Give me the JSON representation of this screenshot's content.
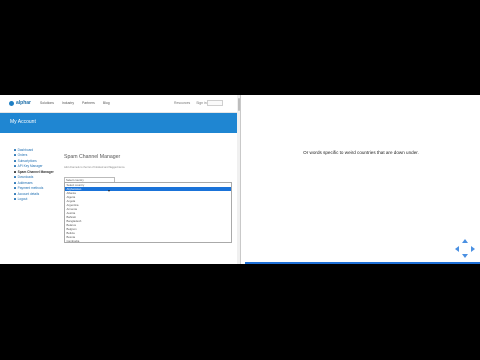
{
  "app": {
    "logo_text": "alphar",
    "nav_links": [
      "Solutions",
      "Industry",
      "Partners",
      "Blog"
    ],
    "nav_right": [
      "Resources",
      "Sign in"
    ]
  },
  "banner": {
    "title": "My Account"
  },
  "sidebar": {
    "items": [
      {
        "label": "Dashboard"
      },
      {
        "label": "Orders"
      },
      {
        "label": "Subscriptions"
      },
      {
        "label": "API Key Manager"
      },
      {
        "label": "Spam Channel Manager",
        "active": true
      },
      {
        "label": "Downloads"
      },
      {
        "label": "Addresses"
      },
      {
        "label": "Payment methods"
      },
      {
        "label": "Account details"
      },
      {
        "label": "Logout"
      }
    ]
  },
  "main": {
    "title": "Spam Channel Manager",
    "description": "Add channels to the list of blocked and flagged items.",
    "select_value": "Select country",
    "options": [
      "Select country",
      "Afghanistan",
      "Albania",
      "Algeria",
      "Angola",
      "Argentina",
      "Armenia",
      "Austria",
      "Bahrain",
      "Bangladesh",
      "Belarus",
      "Belgium",
      "Bolivia",
      "Bosnia",
      "Cambodia",
      "Cameroon",
      "Central African Republic",
      "Colombia",
      "Croatia"
    ],
    "selected_index": 1
  },
  "slide": {
    "caption": "Or words specific to weird countries that are down under."
  },
  "colors": {
    "banner": "#1f86d2",
    "accent": "#1a73d9",
    "progress": "#1e6fd6"
  }
}
